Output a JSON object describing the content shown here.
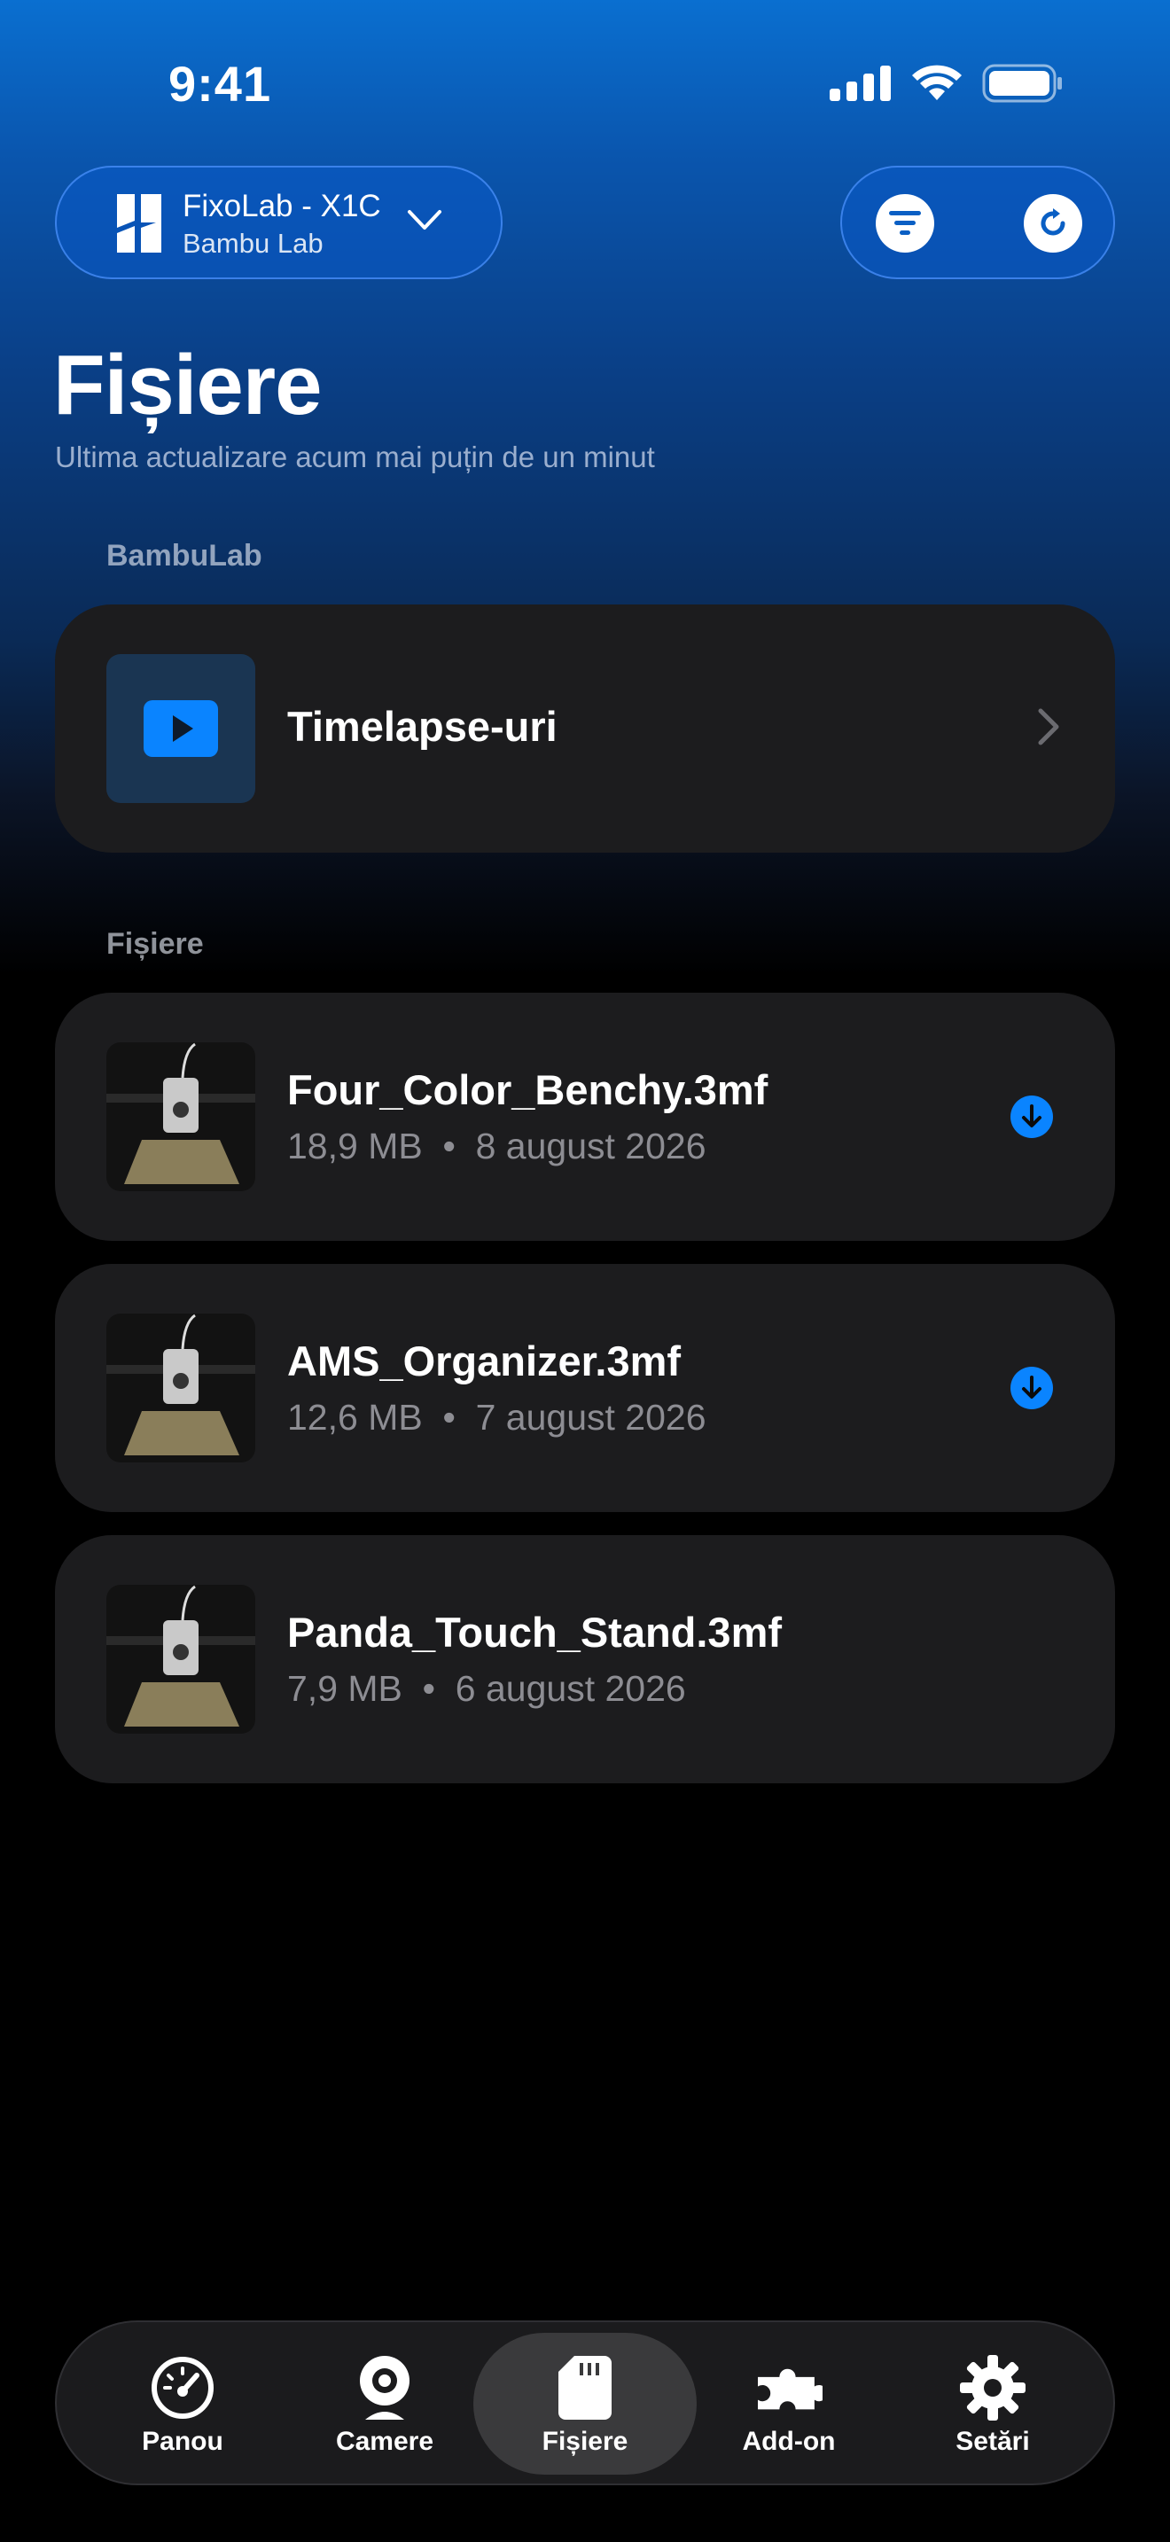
{
  "status_bar": {
    "time": "9:41"
  },
  "printer": {
    "name": "FixoLab - X1C",
    "brand": "Bambu Lab"
  },
  "page": {
    "title": "Fișiere",
    "subtitle": "Ultima actualizare acum mai puțin de un minut"
  },
  "sections": {
    "bambulab_label": "BambuLab",
    "files_label": "Fișiere"
  },
  "timelapse": {
    "label": "Timelapse-uri"
  },
  "files": [
    {
      "name": "Four_Color_Benchy.3mf",
      "meta": "18,9 MB  •  8 august 2026",
      "downloadable": true
    },
    {
      "name": "AMS_Organizer.3mf",
      "meta": "12,6 MB  •  7 august 2026",
      "downloadable": true
    },
    {
      "name": "Panda_Touch_Stand.3mf",
      "meta": "7,9 MB  •  6 august 2026",
      "downloadable": false
    }
  ],
  "tabs": [
    {
      "label": "Panou",
      "icon": "gauge-icon",
      "active": false
    },
    {
      "label": "Camere",
      "icon": "webcam-icon",
      "active": false
    },
    {
      "label": "Fișiere",
      "icon": "sd-card-icon",
      "active": true
    },
    {
      "label": "Add-on",
      "icon": "puzzle-icon",
      "active": false
    },
    {
      "label": "Setări",
      "icon": "gear-icon",
      "active": false
    }
  ],
  "colors": {
    "accent": "#0a84ff",
    "card_bg": "#1c1c1e",
    "secondary_text": "#8d8d93"
  }
}
